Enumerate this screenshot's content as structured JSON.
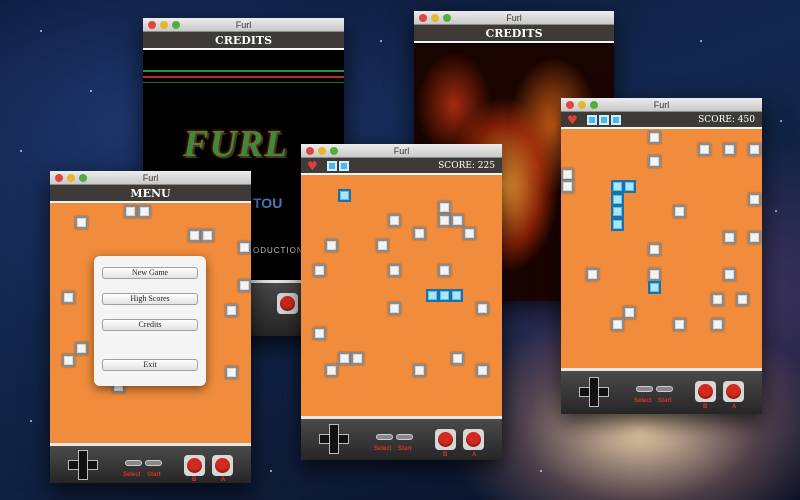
{
  "window_title": "Furl",
  "credits_heading": "CREDITS",
  "menu_heading": "MENU",
  "credits_art": {
    "logo_text": "FURL",
    "fragment_1": "TOU",
    "fragment_2": "ODUCTION"
  },
  "menu": {
    "items": [
      "New Game",
      "High Scores",
      "Credits",
      "Exit"
    ]
  },
  "game_1": {
    "score": "SCORE: 225",
    "lives": 2
  },
  "game_2": {
    "score": "SCORE: 450",
    "lives": 3
  },
  "controls": {
    "select": "Select",
    "start": "Start",
    "b": "B",
    "a": "A"
  },
  "colors": {
    "board": "#f08c3c",
    "header": "#3d3a37",
    "block_blue": "#4cb8ea",
    "button_red": "#d42a1e"
  }
}
